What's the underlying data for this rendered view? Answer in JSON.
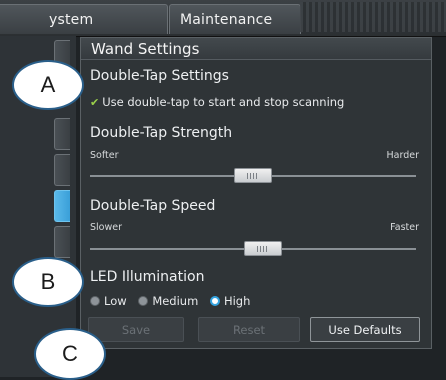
{
  "tabs": {
    "system": "ystem",
    "maintenance": "Maintenance"
  },
  "panel": {
    "title": "Wand Settings",
    "double_tap_settings": {
      "heading": "Double-Tap Settings",
      "option_label": "Use double-tap to start and stop scanning",
      "checked": true
    },
    "strength": {
      "heading": "Double-Tap Strength",
      "min_label": "Softer",
      "max_label": "Harder",
      "level": 0.5
    },
    "speed": {
      "heading": "Double-Tap Speed",
      "min_label": "Slower",
      "max_label": "Faster",
      "level": 0.53
    },
    "led": {
      "heading": "LED Illumination",
      "options": [
        "Low",
        "Medium",
        "High"
      ],
      "selected": "High"
    },
    "buttons": {
      "save": "Save",
      "reset": "Reset",
      "use_defaults": "Use Defaults"
    }
  },
  "callouts": {
    "a": "A",
    "b": "B",
    "c": "C"
  },
  "colors": {
    "accent": "#33a3e0",
    "check": "#9ad04a"
  }
}
